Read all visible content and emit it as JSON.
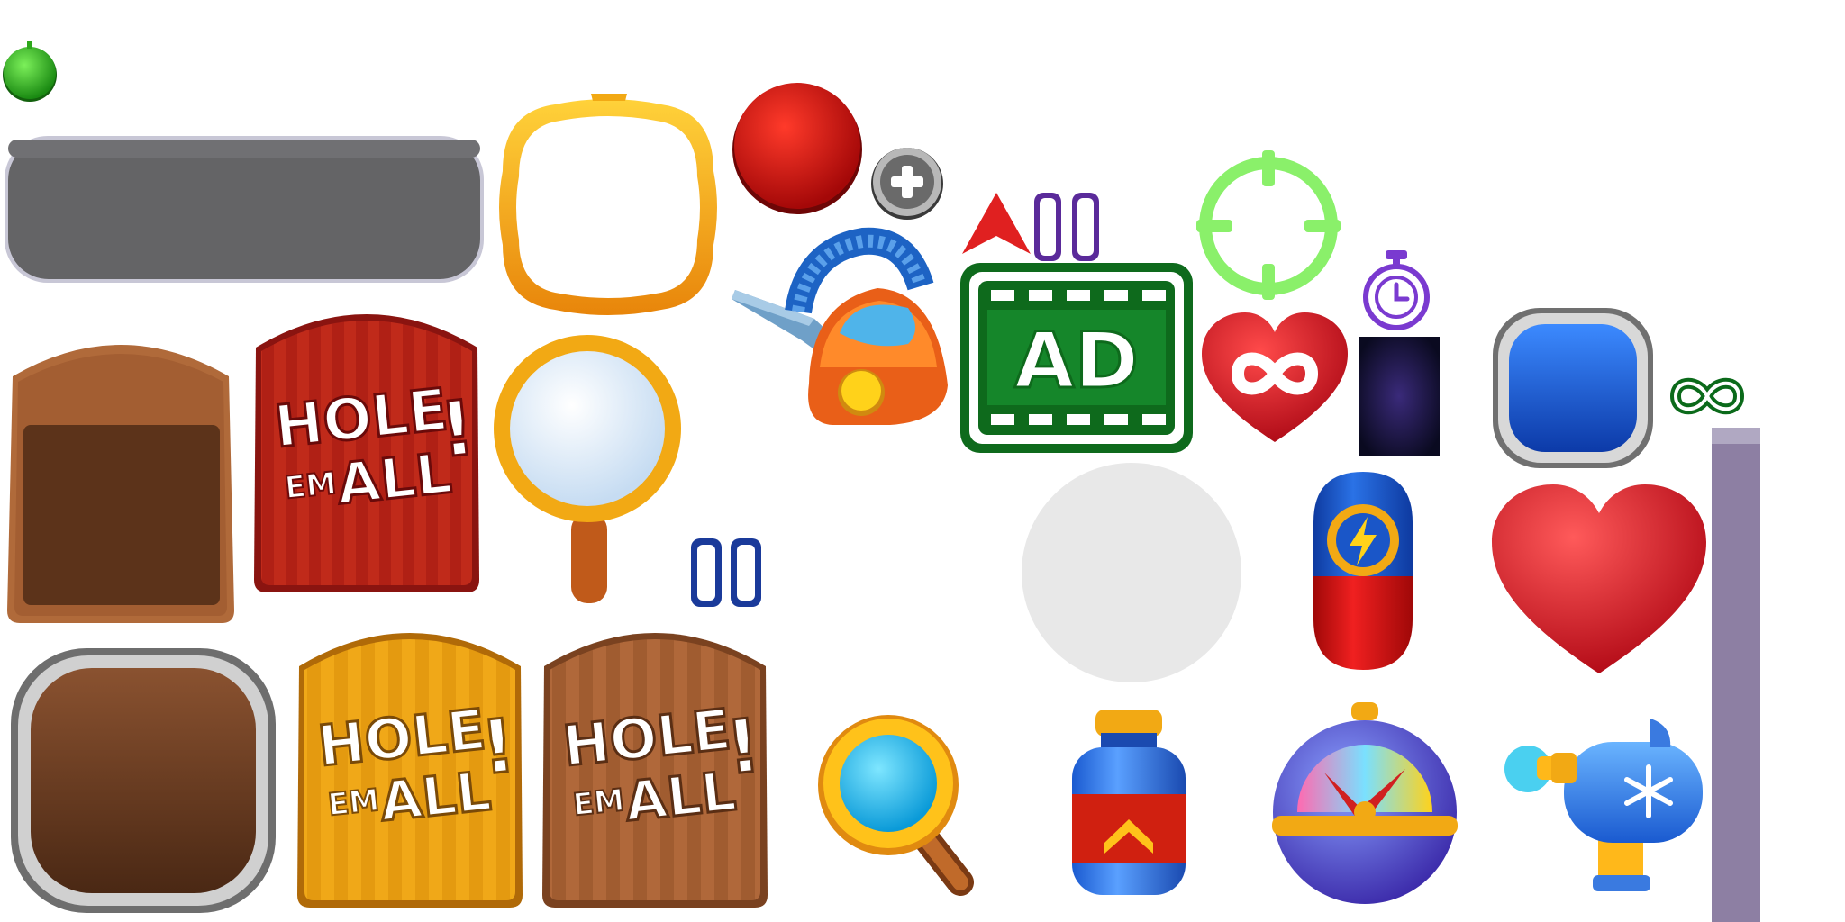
{
  "atlas": {
    "logo": {
      "line1": "HOLE",
      "line2a": "EM",
      "line2b": "ALL",
      "bang": "!"
    },
    "ad_label": "AD",
    "icons": [
      "green-dot-icon",
      "gray-bar-panel",
      "gold-frame-icon",
      "red-button-icon",
      "plus-icon",
      "red-arrow-icon",
      "pause-icon",
      "vacuum-icon",
      "ad-film-icon",
      "crosshair-icon",
      "stopwatch-icon",
      "infinite-heart-icon",
      "dark-panel",
      "blue-button-icon",
      "infinity-icon",
      "purple-bar-panel",
      "brown-panel",
      "red-logo-card",
      "gold-magnifier-icon",
      "pause-small-icon",
      "light-circle",
      "energy-capsule-icon",
      "big-heart-icon",
      "brown-square-button",
      "gold-logo-card",
      "wood-logo-card",
      "magnifier-icon",
      "speed-potion-icon",
      "speed-meter-icon",
      "freeze-gun-icon"
    ],
    "colors": {
      "green": "#2ea81c",
      "red": "#d01010",
      "gold": "#f2a914",
      "blue": "#1a5ad0",
      "brown": "#7a4a2a",
      "gray": "#626265",
      "purple": "#8d7fa3"
    }
  }
}
